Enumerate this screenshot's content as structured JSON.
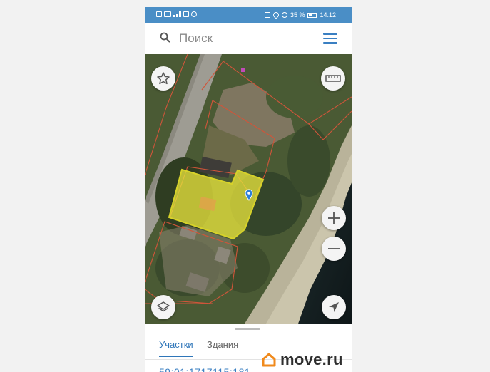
{
  "status_bar": {
    "battery": "35 %",
    "time": "14:12"
  },
  "search": {
    "placeholder": "Поиск"
  },
  "bottom_panel": {
    "tabs": [
      {
        "label": "Участки",
        "active": true
      },
      {
        "label": "Здания",
        "active": false
      }
    ],
    "cadastral_number": "59:01:1717115:181"
  },
  "brand": {
    "text": "move.ru"
  },
  "colors": {
    "status_bar": "#4a8ec6",
    "accent": "#3a7fc2",
    "parcel_fill": "#e6e23c",
    "parcel_outline": "#d7d22a",
    "boundary": "#d0553a",
    "brand_logo": "#f08a1c"
  },
  "icons": {
    "search": "search-icon",
    "menu": "menu-icon",
    "favorite": "star-icon",
    "ruler": "ruler-icon",
    "zoom_in": "plus-icon",
    "zoom_out": "minus-icon",
    "layers": "layers-icon",
    "locate": "navigation-arrow-icon",
    "pin": "location-pin-icon"
  }
}
